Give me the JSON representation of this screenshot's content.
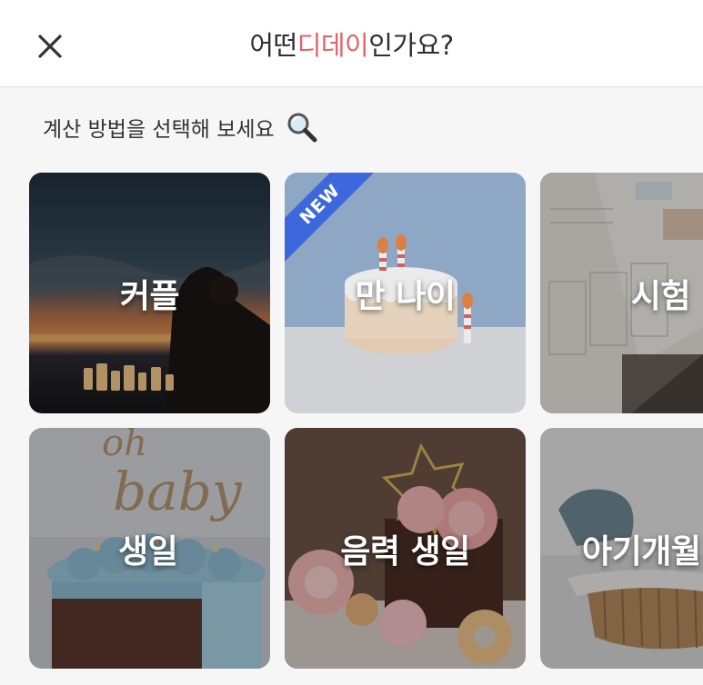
{
  "header": {
    "close_label": "×",
    "title_prefix": "어떤 ",
    "title_accent": "디데이",
    "title_suffix": "인가요?",
    "accent_color": "#e5616b"
  },
  "subtitle": {
    "text": "계산 방법을 선택해 보세요",
    "icon": "magnifier-icon"
  },
  "cards": [
    {
      "label": "커플",
      "badge": ""
    },
    {
      "label": "만 나이",
      "badge": "NEW"
    },
    {
      "label": "시험",
      "badge": ""
    },
    {
      "label": "생일",
      "badge": ""
    },
    {
      "label": "음력 생일",
      "badge": ""
    },
    {
      "label": "아기개월",
      "badge": ""
    }
  ],
  "colors": {
    "badge": "#3d68dd",
    "background": "#f6f6f7"
  }
}
